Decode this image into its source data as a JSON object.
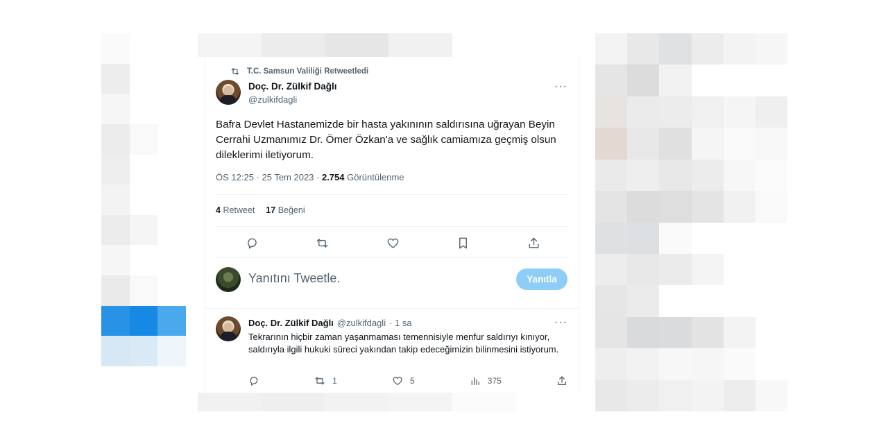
{
  "retweet": {
    "label": "T.C. Samsun Valiliği Retweetledi"
  },
  "tweet": {
    "author_name": "Doç. Dr. Zülkif Dağlı",
    "author_handle": "@zulkifdagli",
    "more": "···",
    "text": "Bafra Devlet Hastanemizde bir hasta yakınının saldırısına uğrayan Beyin Cerrahi Uzmanımız Dr. Ömer Özkan'a ve sağlık camiamıza geçmiş olsun dileklerimi iletiyorum.",
    "time": "ÖS 12:25 · 25 Tem 2023 · ",
    "views": "2.754",
    "views_label": " Görüntülenme",
    "retweets": "4",
    "retweets_label": "Retweet",
    "likes": "17",
    "likes_label": "Beğeni"
  },
  "reply_box": {
    "placeholder": "Yanıtını Tweetle.",
    "button": "Yanıtla"
  },
  "reply": {
    "author_name": "Doç. Dr. Zülkif Dağlı",
    "author_handle": "@zulkifdagli",
    "time": "· 1 sa",
    "more": "···",
    "text": "Tekrarının hiçbir zaman yaşanmaması temennisiyle menfur saldırıyı kınıyor, saldırıyla ilgili hukuki süreci yakından takip edeceğimizin bilinmesini istiyorum.",
    "retweets": "1",
    "likes": "5",
    "views": "375"
  },
  "colors": {
    "accent": "#1d9bf0",
    "reply_button": "#8ecdf8",
    "muted": "#536471"
  },
  "icons": [
    "retweet-icon",
    "reply-icon",
    "like-icon",
    "bookmark-icon",
    "share-icon",
    "views-icon"
  ]
}
